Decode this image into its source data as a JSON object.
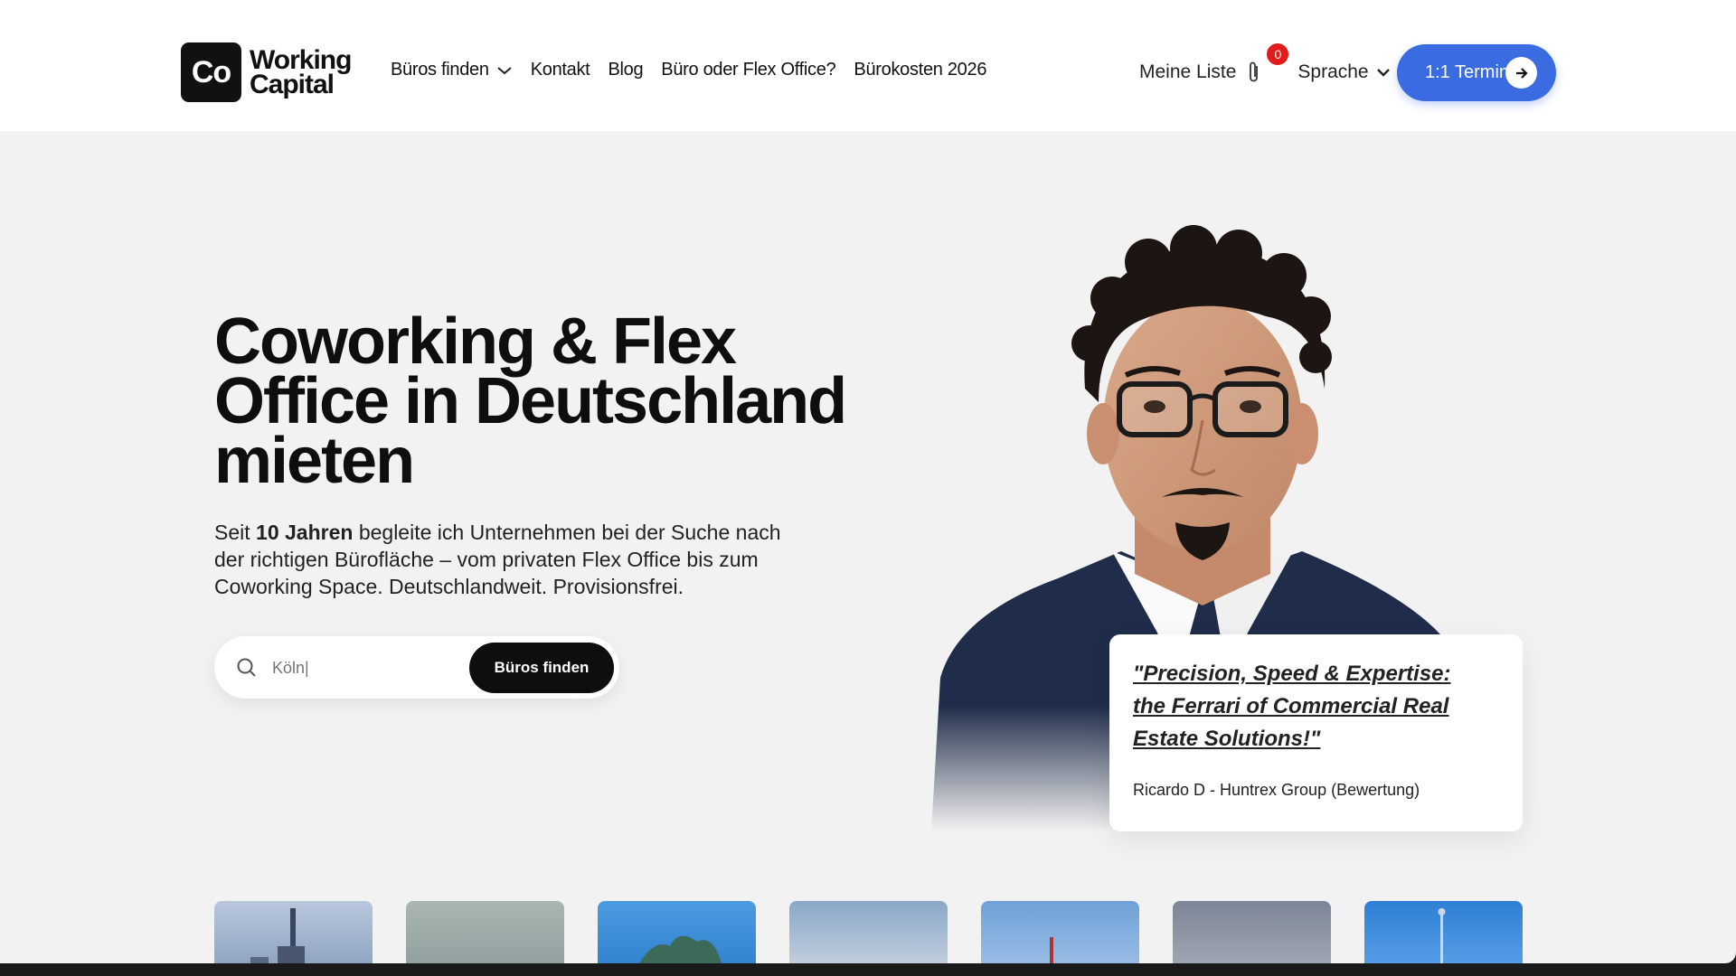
{
  "brand": {
    "logo_mark": "Co",
    "logo_line1": "Working",
    "logo_line2": "Capital"
  },
  "nav": {
    "items": [
      {
        "label": "Büros finden",
        "has_dropdown": true
      },
      {
        "label": "Kontakt"
      },
      {
        "label": "Blog"
      },
      {
        "label": "Büro oder Flex Office?"
      },
      {
        "label": "Bürokosten 2026"
      }
    ],
    "meine_liste": "Meine Liste",
    "list_count": "0",
    "sprache": "Sprache",
    "termin_label": "1:1 Termin"
  },
  "hero": {
    "title": "Coworking & Flex Office in Deutschland mieten",
    "sub_prefix": "Seit ",
    "sub_bold": "10 Jahren",
    "sub_rest": " begleite ich Unternehmen bei der Suche nach der richtigen Bürofläche – vom privaten Flex Office bis zum Coworking Space. Deutschlandweit. Provisionsfrei.",
    "search_placeholder": "Köln|",
    "search_button": "Büros finden"
  },
  "testimonial": {
    "quote": "\"Precision, Speed & Expertise: the Ferrari of Commercial Real Estate Solutions!\"",
    "author": "Ricardo D - Huntrex Group (Bewertung)"
  },
  "colors": {
    "accent": "#3a6be0",
    "badge": "#e21b1b",
    "dark": "#0e0e0e"
  },
  "icons": [
    "chevron-down-icon",
    "paperclip-icon",
    "arrow-right-icon",
    "search-icon"
  ]
}
